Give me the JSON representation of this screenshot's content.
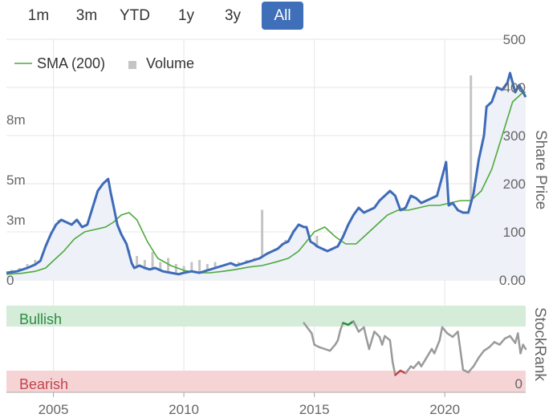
{
  "range_tabs": {
    "items": [
      "1m",
      "3m",
      "YTD",
      "1y",
      "3y",
      "All"
    ],
    "active": "All"
  },
  "colors": {
    "price": "#3e6bb8",
    "sma": "#4caa3c",
    "volume": "#c4c4c4",
    "area": "#eef1f8",
    "bullish_band": "#d4ecd8",
    "bearish_band": "#f6d4d6",
    "bullish_text": "#2e8b45",
    "bearish_text": "#c0454b",
    "rank": "#9a9a9a"
  },
  "chart_data": [
    {
      "type": "line",
      "legend": [
        {
          "name": "SMA (200)",
          "symbol": "line",
          "color": "#4caa3c"
        },
        {
          "name": "Volume",
          "symbol": "square",
          "color": "#c4c4c4"
        }
      ],
      "legend_position": "top-left",
      "ylabel": "Share Price",
      "y_ticks": [
        "0.00",
        "100",
        "200",
        "300",
        "400",
        "500"
      ],
      "ylim": [
        0,
        500
      ],
      "volume_ticks": [
        "0",
        "3m",
        "5m",
        "8m"
      ],
      "volume_lim": [
        0,
        12
      ],
      "x_ticks": [
        2005,
        2010,
        2015,
        2020
      ],
      "xlim": [
        2003.2,
        2023.1
      ],
      "grid": true,
      "series": [
        {
          "name": "Share price",
          "x": [
            2003.2,
            2003.6,
            2004.0,
            2004.3,
            2004.5,
            2004.7,
            2004.9,
            2005.1,
            2005.3,
            2005.5,
            2005.7,
            2005.9,
            2006.1,
            2006.3,
            2006.5,
            2006.7,
            2006.9,
            2007.1,
            2007.2,
            2007.3,
            2007.45,
            2007.6,
            2007.8,
            2008.0,
            2008.1,
            2008.3,
            2008.5,
            2008.7,
            2008.9,
            2009.2,
            2009.5,
            2009.8,
            2010.0,
            2010.3,
            2010.6,
            2010.9,
            2011.2,
            2011.5,
            2011.8,
            2012.0,
            2012.3,
            2012.6,
            2012.9,
            2013.2,
            2013.4,
            2013.6,
            2013.8,
            2014.0,
            2014.2,
            2014.4,
            2014.6,
            2014.7,
            2014.85,
            2015.0,
            2015.1,
            2015.3,
            2015.5,
            2015.7,
            2015.9,
            2016.1,
            2016.3,
            2016.5,
            2016.7,
            2016.9,
            2017.1,
            2017.3,
            2017.5,
            2017.7,
            2017.9,
            2018.1,
            2018.3,
            2018.5,
            2018.7,
            2018.9,
            2019.1,
            2019.3,
            2019.5,
            2019.7,
            2019.9,
            2020.05,
            2020.15,
            2020.3,
            2020.5,
            2020.7,
            2020.9,
            2021.1,
            2021.3,
            2021.5,
            2021.6,
            2021.8,
            2022.0,
            2022.2,
            2022.4,
            2022.5,
            2022.7,
            2022.85,
            2023.0,
            2023.1
          ],
          "y": [
            15,
            18,
            25,
            32,
            40,
            70,
            95,
            115,
            125,
            120,
            115,
            125,
            110,
            115,
            150,
            185,
            200,
            210,
            180,
            155,
            115,
            95,
            75,
            35,
            25,
            30,
            25,
            22,
            25,
            18,
            15,
            12,
            15,
            18,
            15,
            20,
            25,
            30,
            35,
            30,
            35,
            40,
            45,
            55,
            60,
            65,
            75,
            80,
            100,
            115,
            110,
            110,
            80,
            75,
            70,
            65,
            60,
            65,
            70,
            90,
            115,
            135,
            150,
            140,
            145,
            150,
            165,
            175,
            185,
            175,
            145,
            150,
            175,
            170,
            160,
            165,
            170,
            175,
            215,
            245,
            155,
            160,
            145,
            140,
            140,
            180,
            250,
            300,
            360,
            370,
            400,
            395,
            410,
            430,
            390,
            405,
            390,
            380
          ]
        },
        {
          "name": "SMA (200)",
          "x": [
            2003.2,
            2003.8,
            2004.3,
            2004.7,
            2005.0,
            2005.4,
            2005.8,
            2006.2,
            2006.6,
            2007.0,
            2007.3,
            2007.6,
            2007.9,
            2008.2,
            2008.6,
            2009.0,
            2009.5,
            2010.0,
            2010.5,
            2011.0,
            2011.5,
            2012.0,
            2012.5,
            2013.0,
            2013.5,
            2014.0,
            2014.4,
            2014.7,
            2015.0,
            2015.4,
            2015.8,
            2016.2,
            2016.6,
            2017.0,
            2017.4,
            2017.8,
            2018.2,
            2018.6,
            2019.0,
            2019.4,
            2019.8,
            2020.2,
            2020.6,
            2021.0,
            2021.4,
            2021.8,
            2022.2,
            2022.6,
            2023.0,
            2023.1
          ],
          "y": [
            12,
            14,
            18,
            25,
            40,
            60,
            85,
            100,
            105,
            110,
            120,
            135,
            140,
            125,
            80,
            45,
            30,
            20,
            15,
            15,
            18,
            22,
            27,
            30,
            37,
            45,
            60,
            80,
            100,
            110,
            90,
            75,
            75,
            95,
            115,
            135,
            145,
            145,
            150,
            155,
            155,
            160,
            165,
            165,
            185,
            230,
            300,
            370,
            390,
            390
          ]
        }
      ],
      "volume_x": [
        2003.4,
        2003.7,
        2004.0,
        2004.3,
        2004.6,
        2004.9,
        2005.2,
        2005.5,
        2005.8,
        2006.1,
        2006.4,
        2006.7,
        2007.0,
        2007.3,
        2007.6,
        2007.9,
        2008.2,
        2008.5,
        2008.8,
        2009.1,
        2009.4,
        2009.7,
        2010.0,
        2010.3,
        2010.6,
        2010.9,
        2011.2,
        2011.5,
        2011.8,
        2012.1,
        2012.4,
        2012.7,
        2013.0,
        2013.3,
        2013.6,
        2013.9,
        2014.2,
        2014.5,
        2014.8,
        2015.1,
        2015.4,
        2015.7,
        2016.0,
        2016.3,
        2016.6,
        2016.9,
        2017.2,
        2017.5,
        2017.8,
        2018.1,
        2018.4,
        2018.7,
        2019.0,
        2019.3,
        2019.6,
        2019.9,
        2020.2,
        2020.5,
        2020.8,
        2021.0,
        2021.3,
        2021.5,
        2021.8,
        2022.1,
        2022.4,
        2022.7,
        2023.0
      ],
      "volume": [
        0.5,
        0.6,
        0.8,
        1.0,
        1.2,
        1.5,
        3.0,
        2.5,
        1.8,
        1.5,
        2.0,
        1.6,
        2.2,
        3.5,
        2.0,
        1.5,
        1.2,
        1.0,
        1.4,
        0.9,
        1.1,
        0.8,
        0.7,
        0.9,
        1.0,
        0.8,
        0.9,
        0.7,
        0.8,
        0.9,
        1.0,
        1.1,
        3.5,
        1.2,
        1.5,
        2.0,
        2.5,
        2.0,
        1.8,
        2.2,
        1.5,
        1.6,
        1.8,
        2.0,
        2.5,
        2.5,
        1.5,
        3.2,
        2.5,
        3.0,
        1.6,
        2.5,
        2.0,
        1.2,
        1.5,
        2.0,
        1.5,
        1.2,
        1.0,
        10.2,
        1.8,
        1.2,
        1.5,
        1.0,
        1.2,
        1.0,
        0.8
      ]
    },
    {
      "type": "line",
      "ylabel": "StockRank",
      "y_ticks": [
        "0"
      ],
      "ylim": [
        0,
        100
      ],
      "bands": [
        {
          "label": "Bullish",
          "from": 75,
          "to": 100
        },
        {
          "label": "Bearish",
          "from": 0,
          "to": 25
        }
      ],
      "series": [
        {
          "name": "StockRank",
          "x": [
            2014.6,
            2014.8,
            2014.9,
            2015.0,
            2015.2,
            2015.4,
            2015.6,
            2015.8,
            2015.9,
            2016.0,
            2016.1,
            2016.3,
            2016.5,
            2016.7,
            2016.9,
            2017.0,
            2017.1,
            2017.3,
            2017.5,
            2017.6,
            2017.7,
            2017.9,
            2018.0,
            2018.1,
            2018.3,
            2018.5,
            2018.7,
            2018.8,
            2019.0,
            2019.1,
            2019.3,
            2019.5,
            2019.6,
            2019.8,
            2019.9,
            2020.1,
            2020.3,
            2020.5,
            2020.7,
            2020.9,
            2021.1,
            2021.3,
            2021.5,
            2021.7,
            2021.9,
            2022.1,
            2022.3,
            2022.5,
            2022.7,
            2022.8,
            2022.9,
            2023.0,
            2023.1
          ],
          "y": [
            80,
            72,
            68,
            55,
            52,
            50,
            48,
            55,
            60,
            72,
            80,
            78,
            82,
            70,
            75,
            62,
            50,
            70,
            64,
            55,
            65,
            60,
            35,
            20,
            25,
            22,
            30,
            28,
            35,
            30,
            40,
            50,
            45,
            60,
            75,
            68,
            64,
            70,
            26,
            23,
            30,
            40,
            48,
            52,
            58,
            55,
            62,
            65,
            57,
            68,
            45,
            55,
            50
          ]
        }
      ]
    }
  ]
}
